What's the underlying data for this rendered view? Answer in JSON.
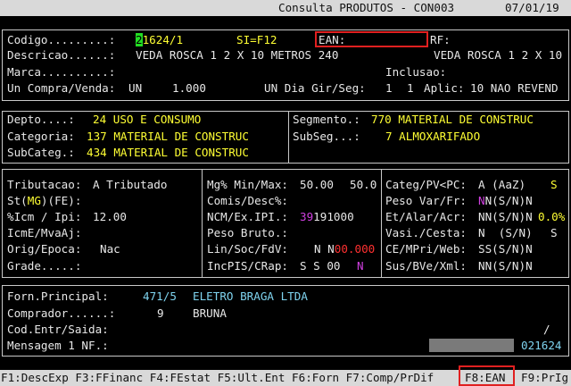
{
  "title": {
    "text": "Consulta PRODUTOS - CON003",
    "date": "07/01/19"
  },
  "header": {
    "codigo_label": "Codigo.........:",
    "codigo_first": "2",
    "codigo_rest": "1624/1",
    "si": "SI=F12",
    "ean_label": "EAN:",
    "rf": "RF:",
    "descricao_label": "Descricao......:",
    "descricao_value": "VEDA ROSCA 1 2 X 10 METROS 240",
    "descricao_value2": "VEDA ROSCA 1 2 X 10",
    "marca_label": "Marca..........:",
    "inclusao_label": "Inclusao:",
    "uncompra_label": "Un Compra/Venda:",
    "uncompra_un": "UN",
    "uncompra_qty": "1.000",
    "undia_label": "UN Dia Gir/Seg:",
    "undia_v1": "1",
    "undia_v2": "1",
    "aplic_label": "Aplic:",
    "aplic_value": "10 NAO REVEND"
  },
  "classif": {
    "depto_label": "Depto....:",
    "depto_value": "24 USO E CONSUMO",
    "categoria_label": "Categoria:",
    "categoria_value": "137 MATERIAL DE CONSTRUC",
    "subcateg_label": "SubCateg.:",
    "subcateg_value": "434 MATERIAL DE CONSTRUC",
    "segmento_label": "Segmento.:",
    "segmento_value": "770 MATERIAL DE CONSTRUC",
    "subseg_label": "SubSeg...:",
    "subseg_value": "7 ALMOXARIFADO"
  },
  "fiscal": {
    "trib_label": "Tributacao:",
    "trib_value": "A Tributado",
    "st_label_a": "St(",
    "st_mg": "MG",
    "st_label_b": ")(FE):",
    "icm_label": "%Icm / Ipi:",
    "icm_value": "12.00",
    "icme_label": "IcmE/MvaAj:",
    "orig_label": "Orig/Epoca:",
    "orig_value": "Nac",
    "grade_label": "Grade.....:"
  },
  "margins": {
    "mg_label": "Mg% Min/Max:",
    "mg_min": "50.00",
    "mg_max": "50.0",
    "comis_label": "Comis/Desc%:",
    "ncm_label": "NCM/Ex.IPI.:",
    "ncm_pre": "39",
    "ncm_value": "191000",
    "peso_label": "Peso Bruto.:",
    "lin_label": "Lin/Soc/FdV:",
    "lin_value": "N N",
    "lin_red": "00.000",
    "inc_label": "IncPIS/CRap:",
    "inc_value": "S S 00",
    "inc_n": "N"
  },
  "flags": {
    "categ_label": "Categ/PV<PC:",
    "categ_value": "A (AaZ)",
    "categ_s": "S",
    "peso_label": "Peso Var/Fr:",
    "peso_n1": "N",
    "peso_rest": "N(S/N)N",
    "et_label": "Et/Alar/Acr:",
    "et_value": "NN(S/N)N",
    "et_pct": "0.0%",
    "vasi_label": "Vasi./Cesta:",
    "vasi_value": "N  (S/N)",
    "vasi_s": "S",
    "ce_label": "CE/MPri/Web:",
    "ce_value": "SS(S/N)N",
    "sus_label": "Sus/BVe/Xml:",
    "sus_value": "NN(S/N)N"
  },
  "supplier": {
    "forn_label": "Forn.Principal:",
    "forn_code": "471/5",
    "forn_name": "ELETRO BRAGA LTDA",
    "comprador_label": "Comprador......:",
    "comprador_code": "9",
    "comprador_name": "BRUNA",
    "cod_label": "Cod.Entr/Saida:",
    "cod_slash": "/",
    "msg_label": "Mensagem 1 NF.:",
    "msg_code": "021624"
  },
  "fkeys": {
    "line": "F1:DescExp F3:FFinanc F4:FEstat F5:Ult.Ent F6:Forn F7:Comp/PrDif",
    "f8": "F8:EAN",
    "f9": "F9:PrIg"
  },
  "colors": {
    "background": "#000000",
    "label": "#e8e8e8",
    "value": "#ffff33",
    "highlight": "#e02020"
  }
}
